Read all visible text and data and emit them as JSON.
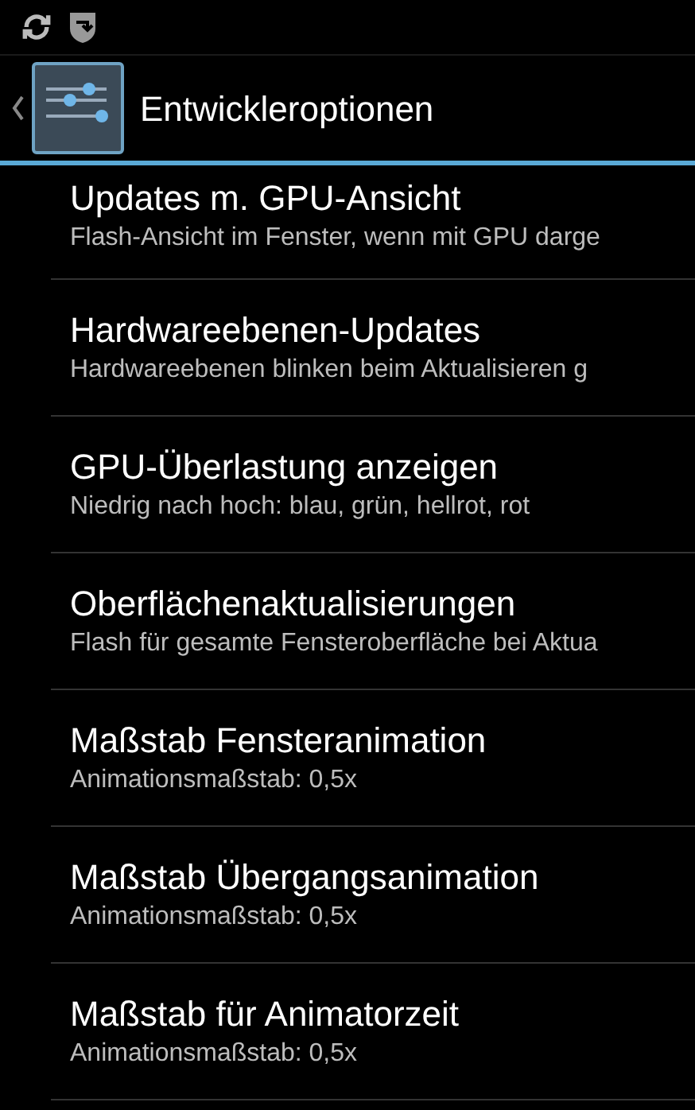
{
  "action_bar": {
    "title": "Entwickleroptionen"
  },
  "settings": [
    {
      "title": "Updates m. GPU-Ansicht",
      "summary": "Flash-Ansicht im Fenster, wenn mit GPU darge"
    },
    {
      "title": "Hardwareebenen-Updates",
      "summary": "Hardwareebenen blinken beim Aktualisieren g"
    },
    {
      "title": "GPU-Überlastung anzeigen",
      "summary": "Niedrig nach hoch: blau, grün, hellrot, rot"
    },
    {
      "title": "Oberflächenaktualisierungen",
      "summary": "Flash für gesamte Fensteroberfläche bei Aktua"
    },
    {
      "title": "Maßstab Fensteranimation",
      "summary": "Animationsmaßstab: 0,5x"
    },
    {
      "title": "Maßstab Übergangsanimation",
      "summary": "Animationsmaßstab: 0,5x"
    },
    {
      "title": "Maßstab für Animatorzeit",
      "summary": "Animationsmaßstab: 0,5x"
    }
  ]
}
